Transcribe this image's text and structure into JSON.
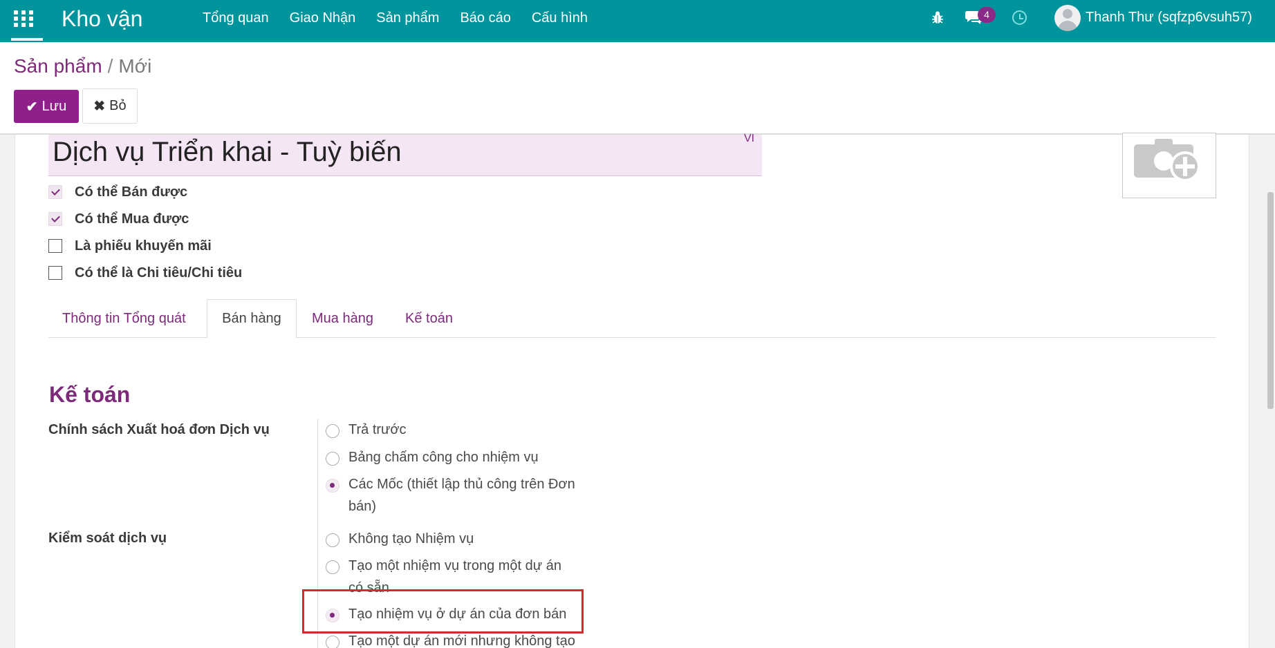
{
  "navbar": {
    "brand": "Kho vận",
    "menu": [
      "Tổng quan",
      "Giao Nhận",
      "Sản phẩm",
      "Báo cáo",
      "Cấu hình"
    ],
    "message_count": "4",
    "user_name": "Thanh Thư (sqfzp6vsuh57)"
  },
  "breadcrumb": {
    "parent": "Sản phẩm",
    "separator": "/",
    "current": "Mới"
  },
  "buttons": {
    "save": "Lưu",
    "discard": "Bỏ"
  },
  "product": {
    "name": "Dịch vụ Triển khai - Tuỳ biến",
    "lang": "VI"
  },
  "checkboxes": [
    {
      "label": "Có thể Bán được",
      "checked": true
    },
    {
      "label": "Có thể Mua được",
      "checked": true
    },
    {
      "label": "Là phiếu khuyến mãi",
      "checked": false
    },
    {
      "label": "Có thể là Chi tiêu/Chi tiêu",
      "checked": false
    }
  ],
  "tabs": [
    "Thông tin Tổng quát",
    "Bán hàng",
    "Mua hàng",
    "Kế toán"
  ],
  "active_tab": "Bán hàng",
  "section": {
    "title": "Kế toán"
  },
  "invoice_policy": {
    "label": "Chính sách Xuất hoá đơn Dịch vụ",
    "options": [
      {
        "text": "Trả trước",
        "checked": false
      },
      {
        "text": "Bảng chấm công cho nhiệm vụ",
        "checked": false
      },
      {
        "line1": "Các Mốc (thiết lập thủ công trên Đơn",
        "line2": "bán)",
        "checked": true
      }
    ]
  },
  "service_tracking": {
    "label": "Kiểm soát dịch vụ",
    "options": [
      {
        "text": "Không tạo Nhiệm vụ",
        "checked": false
      },
      {
        "line1": "Tạo một nhiệm vụ trong một dự án",
        "line2": "có sẵn",
        "checked": false
      },
      {
        "text": "Tạo nhiệm vụ ở dự án của đơn bán",
        "checked": true
      },
      {
        "text": "Tạo một dự án mới nhưng không tạo",
        "checked": false
      }
    ]
  },
  "colors": {
    "navbar": "#00949d",
    "accent": "#7c2a79",
    "highlight": "#d42a2a"
  }
}
